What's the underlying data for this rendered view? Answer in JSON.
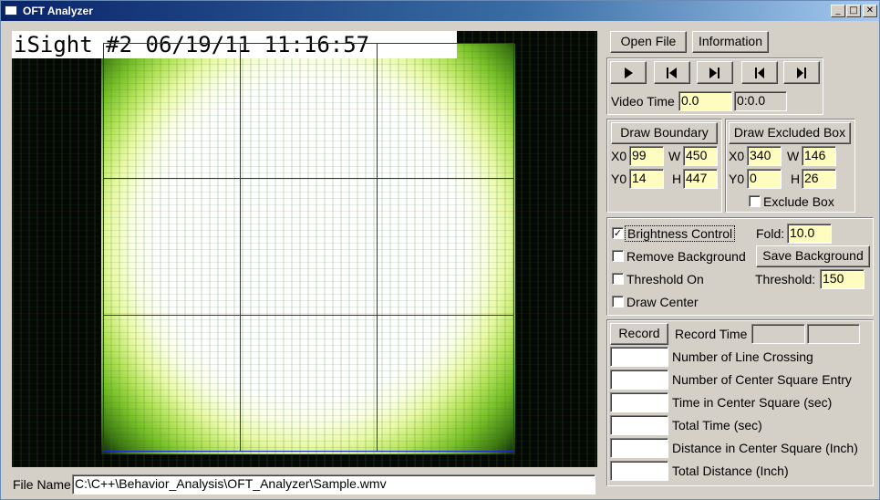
{
  "window": {
    "title": "OFT Analyzer",
    "controls": [
      "_",
      "□",
      "✕"
    ]
  },
  "video": {
    "overlay_text": "iSight #2 06/19/11 11:16:57"
  },
  "file": {
    "label": "File Name",
    "path": "C:\\C++\\Behavior_Analysis\\OFT_Analyzer\\Sample.wmv"
  },
  "top_buttons": {
    "open": "Open File",
    "info": "Information"
  },
  "playback": {
    "buttons": [
      "play-icon",
      "step-back-icon",
      "step-forward-icon",
      "skip-to-start-icon",
      "skip-to-end-icon"
    ],
    "video_time_label": "Video Time",
    "video_time_value": "0.0",
    "video_time_clock": "0:0.0"
  },
  "boundary": {
    "button": "Draw Boundary",
    "x0_label": "X0",
    "x0": "99",
    "w_label": "W",
    "w": "450",
    "y0_label": "Y0",
    "y0": "14",
    "h_label": "H",
    "h": "447"
  },
  "excluded": {
    "button": "Draw Excluded Box",
    "x0_label": "X0",
    "x0": "340",
    "w_label": "W",
    "w": "146",
    "y0_label": "Y0",
    "y0": "0",
    "h_label": "H",
    "h": "26",
    "exclude_label": "Exclude Box",
    "exclude_checked": false
  },
  "processing": {
    "brightness_label": "Brightness Control",
    "brightness_checked": true,
    "fold_label": "Fold:",
    "fold_value": "10.0",
    "remove_bg_label": "Remove Background",
    "remove_bg_checked": false,
    "save_bg_button": "Save Background",
    "threshold_on_label": "Threshold On",
    "threshold_on_checked": false,
    "threshold_label": "Threshold:",
    "threshold_value": "150",
    "draw_center_label": "Draw Center",
    "draw_center_checked": false
  },
  "results": {
    "record_button": "Record",
    "record_time_label": "Record Time",
    "rows": [
      {
        "label": "Number of Line Crossing",
        "value": ""
      },
      {
        "label": "Number of Center Square Entry",
        "value": ""
      },
      {
        "label": "Time in Center Square (sec)",
        "value": ""
      },
      {
        "label": "Total Time (sec)",
        "value": ""
      },
      {
        "label": "Distance in Center Square (Inch)",
        "value": ""
      },
      {
        "label": "Total Distance (Inch)",
        "value": ""
      }
    ]
  }
}
